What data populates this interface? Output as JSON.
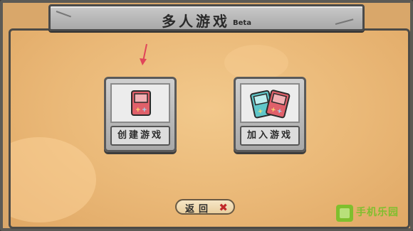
{
  "header": {
    "title": "多人游戏",
    "badge": "Beta"
  },
  "options": [
    {
      "label": "创建游戏",
      "icon": "single-handheld-console-icon"
    },
    {
      "label": "加入游戏",
      "icon": "two-handheld-consoles-icon"
    }
  ],
  "footer": {
    "back_label": "返回",
    "back_icon": "close-x-icon"
  },
  "watermark": {
    "text": "手机乐园"
  },
  "colors": {
    "panel": "#eab877",
    "stone": "#b5b5b5",
    "console_red": "#e0606a",
    "console_teal": "#5fc6c9",
    "arrow": "#e0455a",
    "close_red": "#c0282a",
    "watermark_green": "#7fbf2e"
  }
}
